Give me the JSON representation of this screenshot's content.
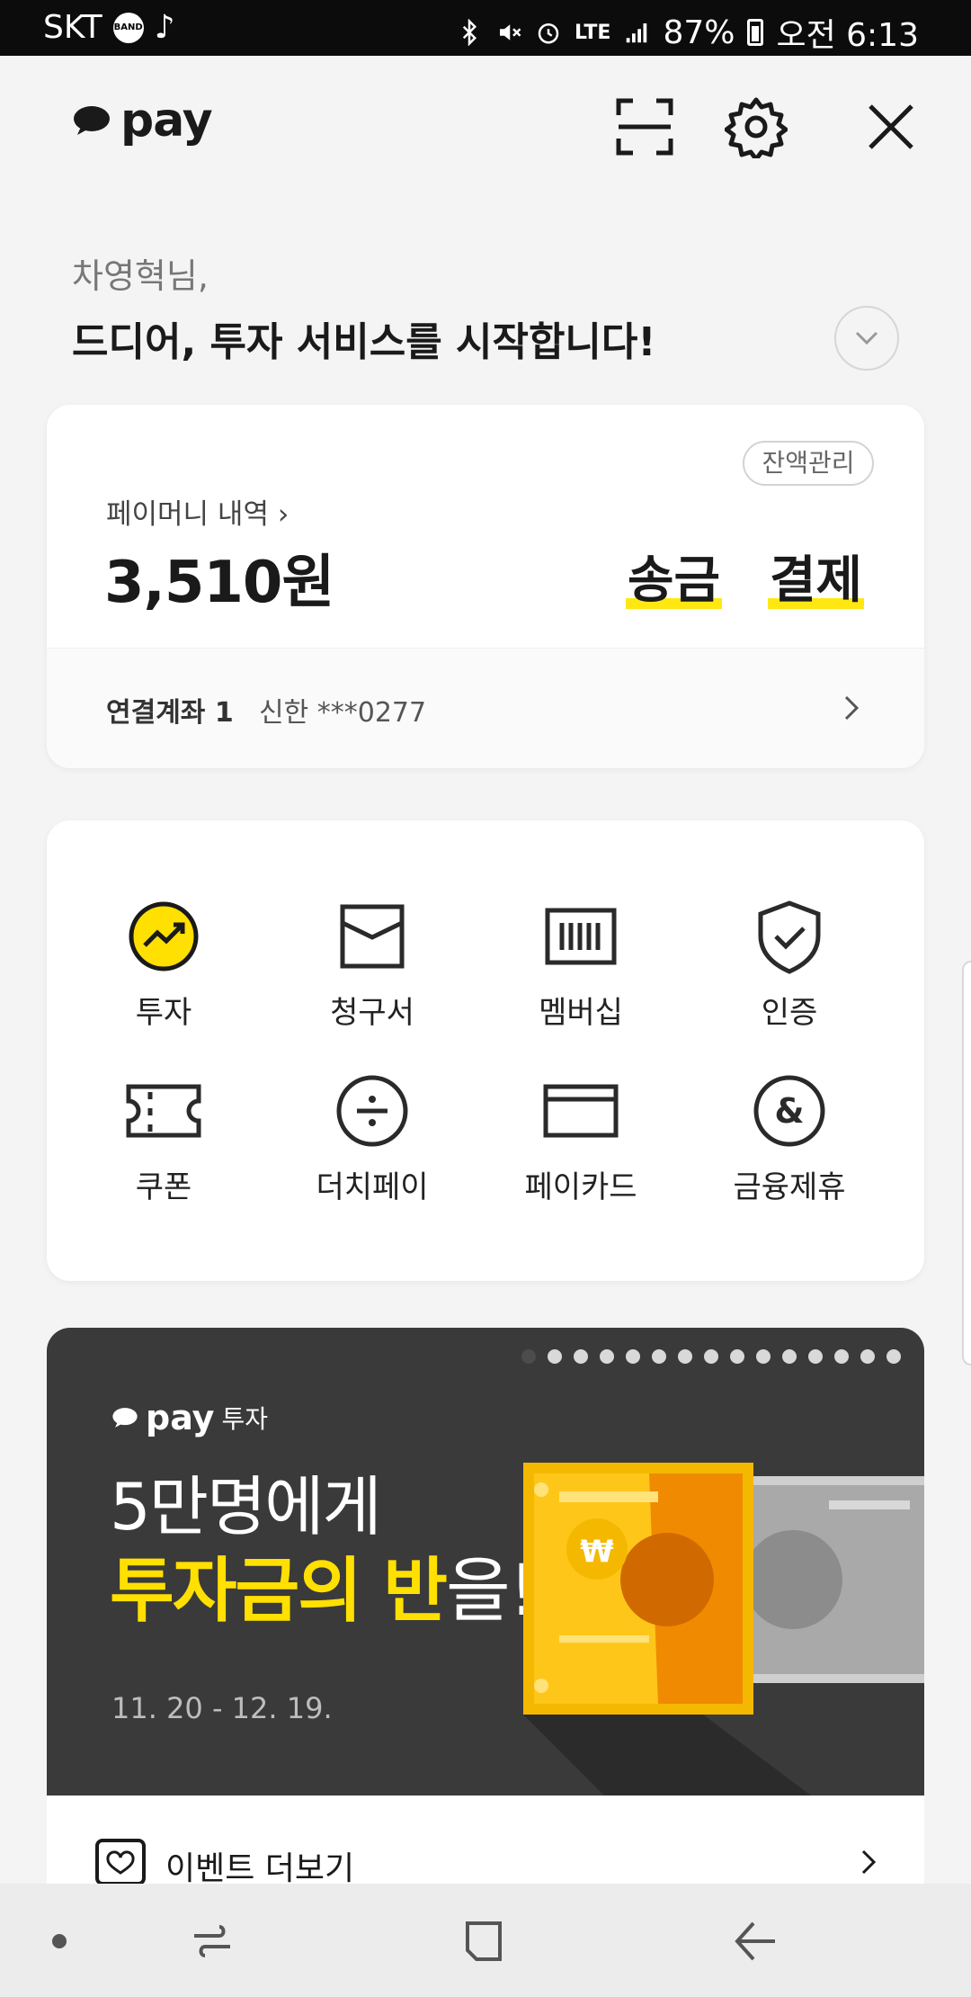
{
  "status": {
    "carrier": "SKT",
    "band": "BAND",
    "network": "LTE",
    "battery": "87%",
    "time": "오전 6:13"
  },
  "header": {
    "logo_text": "pay"
  },
  "greeting": {
    "name": "차영혁님,",
    "message": "드디어, 투자 서비스를 시작합니다!"
  },
  "balance_card": {
    "manage_label": "잔액관리",
    "history_label": "페이머니 내역 ›",
    "amount": "3,510원",
    "send_label": "송금",
    "pay_label": "결제",
    "account_label": "연결계좌 1",
    "account_value": "신한 ***0277"
  },
  "menu": {
    "items": [
      {
        "label": "투자",
        "icon": "invest-icon"
      },
      {
        "label": "청구서",
        "icon": "bill-icon"
      },
      {
        "label": "멤버십",
        "icon": "membership-icon"
      },
      {
        "label": "인증",
        "icon": "certification-icon"
      },
      {
        "label": "쿠폰",
        "icon": "coupon-icon"
      },
      {
        "label": "더치페이",
        "icon": "dutch-pay-icon"
      },
      {
        "label": "페이카드",
        "icon": "pay-card-icon"
      },
      {
        "label": "금융제휴",
        "icon": "finance-partner-icon"
      }
    ]
  },
  "banner": {
    "tag_pay": "pay",
    "tag_service": "투자",
    "line1": "5만명에게",
    "line2_highlight": "투자금의 반",
    "line2_rest": "을!",
    "dates": "11. 20 - 12. 19.",
    "pager_total": 15,
    "pager_active": 1
  },
  "event_more": {
    "label": "이벤트 더보기"
  },
  "colors": {
    "accent_yellow": "#ffe812",
    "banner_bg": "#3a3a3a"
  }
}
